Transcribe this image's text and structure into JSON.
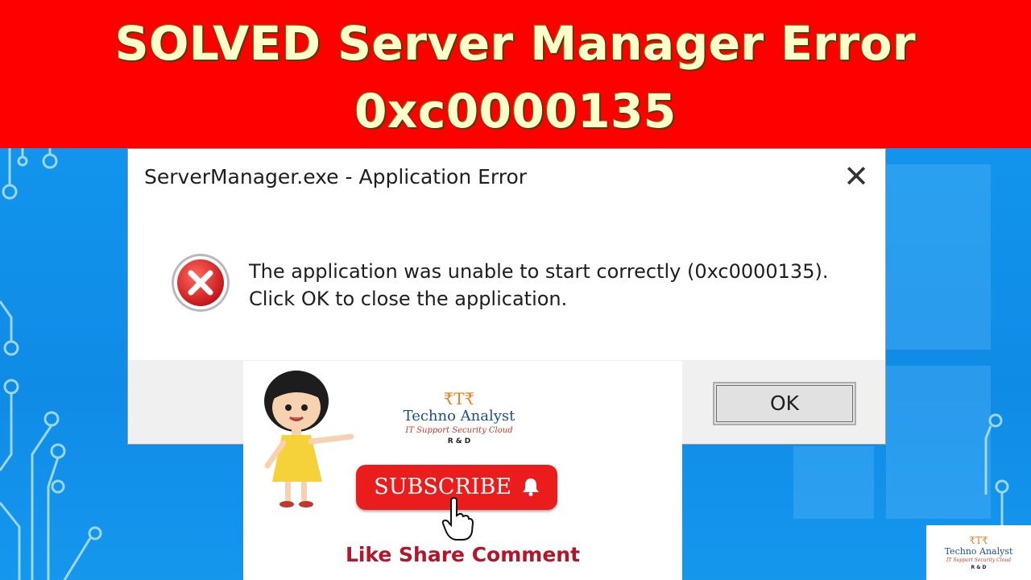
{
  "banner": {
    "title_line1": "SOLVED Server Manager Error",
    "title_line2": "0xc0000135"
  },
  "dialog": {
    "title": "ServerManager.exe - Application Error",
    "close_symbol": "✕",
    "icon": "error-icon",
    "message_line1": "The application was unable to start correctly (0xc0000135).",
    "message_line2": "Click OK to close the application.",
    "ok_label": "OK"
  },
  "promo": {
    "brand_mark": "₹T₹",
    "brand_name": "Techno Analyst",
    "brand_tagline": "IT Support Security Cloud",
    "brand_rd": "R & D",
    "subscribe_label": "SUBSCRIBE",
    "bell_icon": "bell-icon",
    "hand_icon": "pointer-hand-icon",
    "like_share": "Like Share Comment"
  },
  "corner_logo": {
    "brand_mark": "₹T₹",
    "brand_name": "Techno Analyst",
    "brand_tagline": "IT Support Security Cloud",
    "brand_rd": "R & D"
  },
  "colors": {
    "banner_red": "#ff0000",
    "banner_text": "#ffffcc",
    "desktop_blue": "#1294ec",
    "subscribe_red": "#ea1c1c",
    "like_text": "#b3152a"
  }
}
